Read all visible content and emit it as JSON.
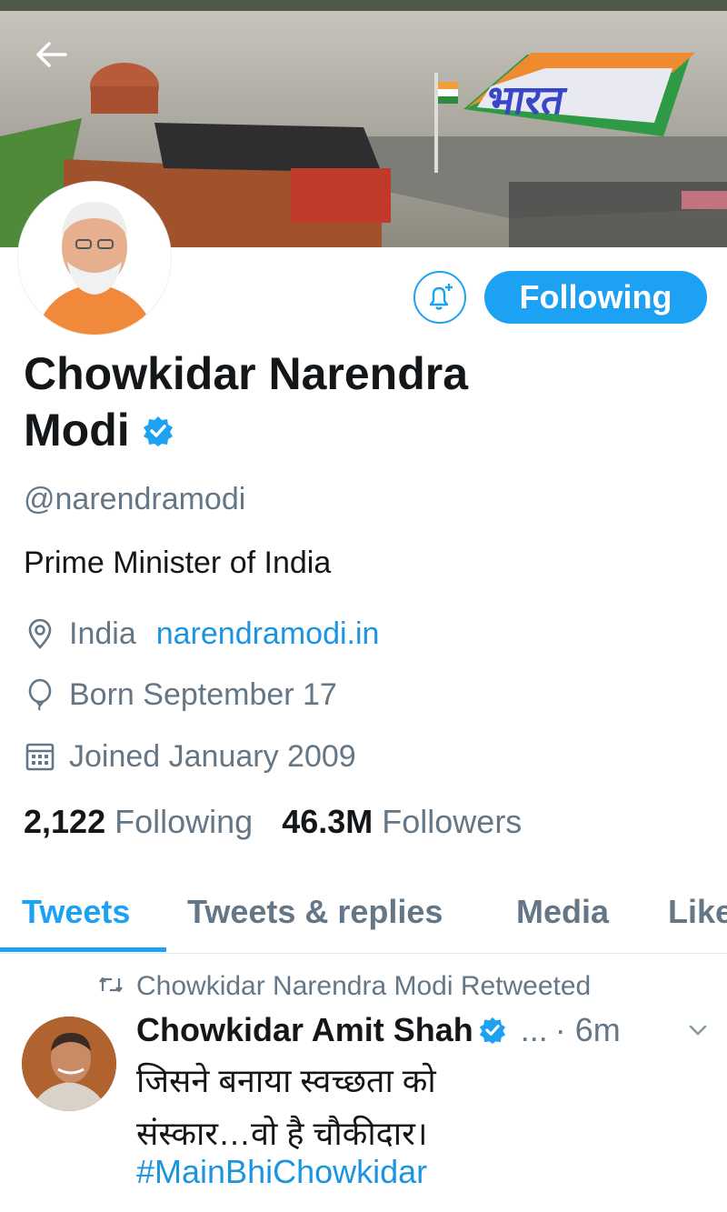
{
  "header": {
    "back_icon": "arrow-left-icon",
    "banner_sign_text": "भारत"
  },
  "profile": {
    "name_line1": "Chowkidar Narendra",
    "name_line2": "Modi",
    "verified_icon": "verified-badge-icon",
    "handle": "@narendramodi",
    "bio": "Prime Minister of India",
    "location": "India",
    "website": "narendramodi.in",
    "birthday": "Born September 17",
    "joined": "Joined January 2009",
    "following_count": "2,122",
    "following_label": "Following",
    "followers_count": "46.3M",
    "followers_label": "Followers"
  },
  "actions": {
    "notify_icon": "bell-plus-icon",
    "follow_button_label": "Following"
  },
  "tabs": [
    {
      "label": "Tweets",
      "active": true
    },
    {
      "label": "Tweets & replies",
      "active": false
    },
    {
      "label": "Media",
      "active": false
    },
    {
      "label": "Likes",
      "active": false
    }
  ],
  "tweet": {
    "retweet_context": "Chowkidar Narendra Modi Retweeted",
    "author": "Chowkidar Amit Shah",
    "overflow": "...",
    "time": "· 6m",
    "text_line1": "जिसने बनाया स्वच्छता को",
    "text_line2": "संस्कार…वो है चौकीदार।",
    "hashtag": "#MainBhiChowkidar"
  },
  "colors": {
    "accent": "#1da1f2",
    "link": "#1b95e0",
    "secondary_text": "#657786",
    "primary_text": "#14171a"
  }
}
